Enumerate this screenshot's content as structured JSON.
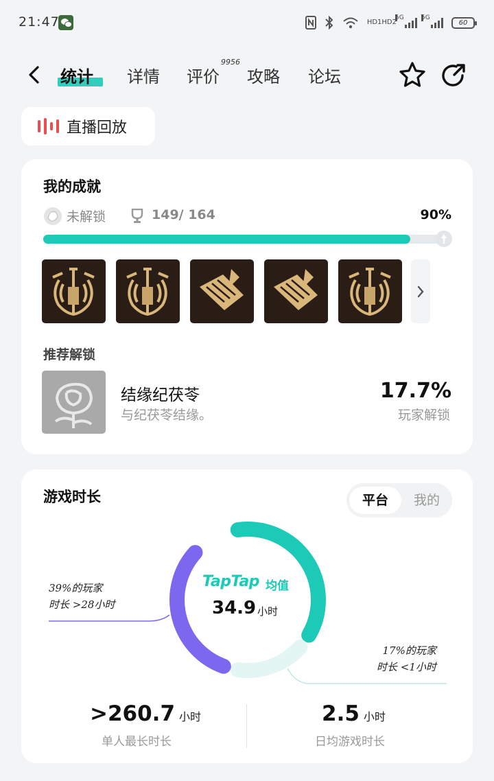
{
  "status_bar": {
    "time": "21:47",
    "battery": "60",
    "hd_label_1": "HD1",
    "hd_label_2": "HD2",
    "net_label_1": "5G",
    "net_label_2": "5G"
  },
  "nav": {
    "tabs": [
      {
        "label": "统计",
        "active": true
      },
      {
        "label": "详情"
      },
      {
        "label": "评价",
        "badge": "9956"
      },
      {
        "label": "攻略"
      },
      {
        "label": "论坛"
      }
    ]
  },
  "live_replay": {
    "label": "直播回放"
  },
  "achievements": {
    "title": "我的成就",
    "locked_label": "未解锁",
    "count": "149/ 164",
    "percent_label": "90%",
    "progress": 0.9,
    "recommend_title": "推荐解锁",
    "recommend": {
      "name": "结缘纪茯苓",
      "description": "与纪茯苓结缘。",
      "percent": "17.7%",
      "sub": "玩家解锁"
    }
  },
  "playtime": {
    "title": "游戏时长",
    "toggle": [
      "平台",
      "我的"
    ],
    "avg_brand": "TapTap",
    "avg_suffix": "均值",
    "avg_value": "34.9",
    "avg_unit": "小时",
    "note_left_1": "39%的玩家",
    "note_left_2": "时长 >28小时",
    "note_right_1": "17%的玩家",
    "note_right_2": "时长 <1小时",
    "stats": [
      {
        "value": ">260.7",
        "unit": "小时",
        "label": "单人最长时长"
      },
      {
        "value": "2.5",
        "unit": "小时",
        "label": "日均游戏时长"
      }
    ],
    "colors": {
      "teal": "#1dcab8",
      "purple": "#7b68ee",
      "light": "#e3f6f4"
    }
  }
}
